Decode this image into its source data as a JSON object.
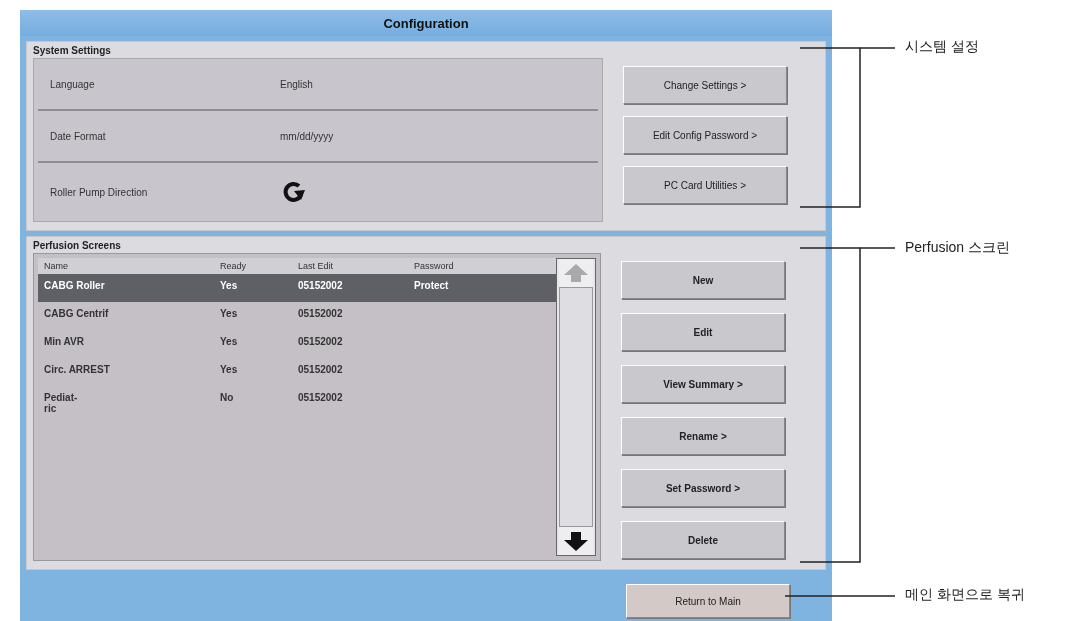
{
  "window": {
    "title": "Configuration"
  },
  "system_settings": {
    "title": "System Settings",
    "rows": [
      {
        "label": "Language",
        "value": "English",
        "kind": "text"
      },
      {
        "label": "Date Format",
        "value": "mm/dd/yyyy",
        "kind": "text"
      },
      {
        "label": "Roller Pump Direction",
        "kind": "icon"
      }
    ],
    "buttons": [
      "Change Settings >",
      "Edit Config Password >",
      "PC Card Utilities >"
    ]
  },
  "perfusion_screens": {
    "title": "Perfusion Screens",
    "columns": [
      "Name",
      "Ready",
      "Last Edit",
      "Password"
    ],
    "rows": [
      {
        "name": "CABG Roller",
        "ready": "Yes",
        "last_edit": "05152002",
        "password": "Protect",
        "selected": true
      },
      {
        "name": "CABG Centrif",
        "ready": "Yes",
        "last_edit": "05152002",
        "password": "",
        "selected": false
      },
      {
        "name": "Min AVR",
        "ready": "Yes",
        "last_edit": "05152002",
        "password": "",
        "selected": false
      },
      {
        "name": "Circ. ARREST",
        "ready": "Yes",
        "last_edit": "05152002",
        "password": "",
        "selected": false
      },
      {
        "name": "Pediat-\nric",
        "ready": "No",
        "last_edit": "05152002",
        "password": "",
        "selected": false
      }
    ],
    "buttons": [
      "New",
      "Edit",
      "View Summary >",
      "Rename >",
      "Set Password >",
      "Delete"
    ]
  },
  "footer_button": "Return to Main",
  "annotations": [
    "시스템 설정",
    "Perfusion 스크린",
    "메인 화면으로 복귀"
  ]
}
